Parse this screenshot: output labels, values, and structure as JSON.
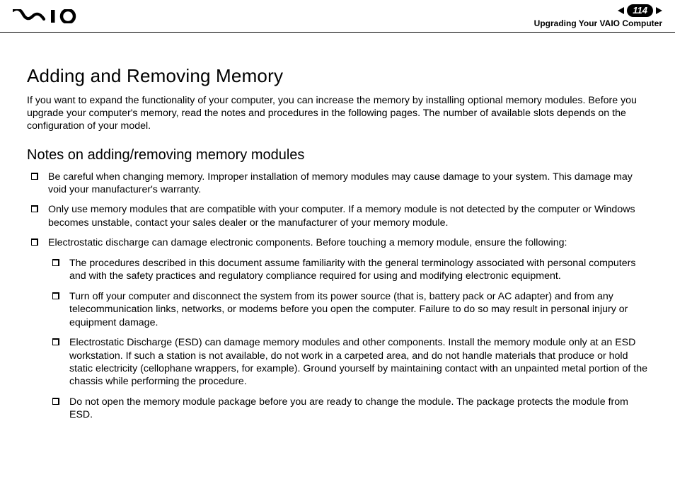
{
  "header": {
    "page_number": "114",
    "section": "Upgrading Your VAIO Computer"
  },
  "content": {
    "title": "Adding and Removing Memory",
    "intro": "If you want to expand the functionality of your computer, you can increase the memory by installing optional memory modules. Before you upgrade your computer's memory, read the notes and procedures in the following pages. The number of available slots depends on the configuration of your model.",
    "subtitle": "Notes on adding/removing memory modules",
    "notes": [
      "Be careful when changing memory. Improper installation of memory modules may cause damage to your system. This damage may void your manufacturer's warranty.",
      "Only use memory modules that are compatible with your computer. If a memory module is not detected by the computer or Windows becomes unstable, contact your sales dealer or the manufacturer of your memory module.",
      "Electrostatic discharge can damage electronic components. Before touching a memory module, ensure the following:"
    ],
    "subnotes": [
      "The procedures described in this document assume familiarity with the general terminology associated with personal computers and with the safety practices and regulatory compliance required for using and modifying electronic equipment.",
      "Turn off your computer and disconnect the system from its power source (that is, battery pack or AC adapter) and from any telecommunication links, networks, or modems before you open the computer. Failure to do so may result in personal injury or equipment damage.",
      "Electrostatic Discharge (ESD) can damage memory modules and other components. Install the memory module only at an ESD workstation. If such a station is not available, do not work in a carpeted area, and do not handle materials that produce or hold static electricity (cellophane wrappers, for example). Ground yourself by maintaining contact with an unpainted metal portion of the chassis while performing the procedure.",
      "Do not open the memory module package before you are ready to change the module. The package protects the module from ESD."
    ]
  }
}
